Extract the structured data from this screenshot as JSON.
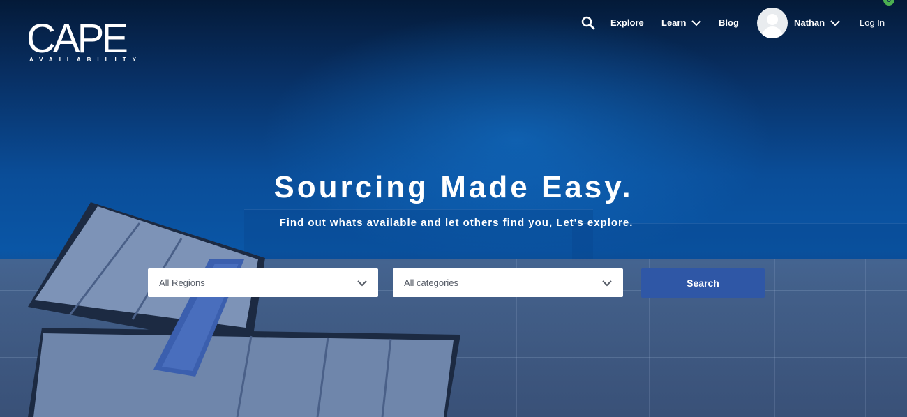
{
  "brand": {
    "name": "CAPE",
    "tagline": "AVAILABILITY"
  },
  "nav": {
    "search_icon": "search-icon",
    "explore": "Explore",
    "learn": "Learn",
    "blog": "Blog",
    "user_name": "Nathan",
    "login": "Log In",
    "notification_count": "0"
  },
  "hero": {
    "headline": "Sourcing Made Easy.",
    "subline": "Find out whats available and let others find you, Let's explore."
  },
  "search": {
    "region_select": "All Regions",
    "category_select": "All categories",
    "submit_label": "Search"
  },
  "colors": {
    "accent_button": "#2f57a6",
    "badge": "#4caf50",
    "hero_blue": "#0a56a6"
  }
}
